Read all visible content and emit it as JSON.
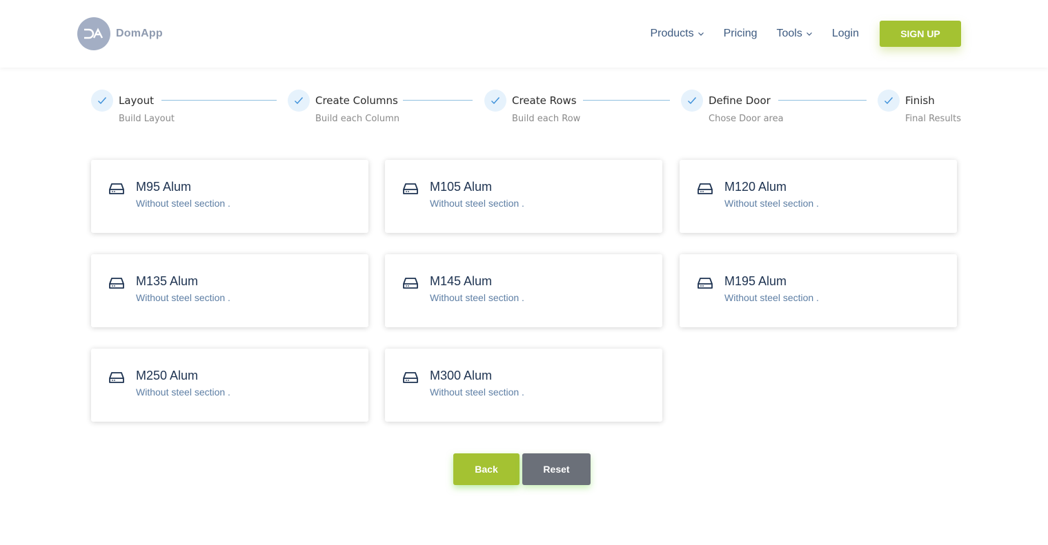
{
  "brand": {
    "initials": "DA",
    "name": "DomApp"
  },
  "nav": {
    "products": "Products",
    "pricing": "Pricing",
    "tools": "Tools",
    "login": "Login",
    "signup": "SIGN UP"
  },
  "steps": [
    {
      "title": "Layout",
      "subtitle": "Build Layout"
    },
    {
      "title": "Create Columns",
      "subtitle": "Build each Column"
    },
    {
      "title": "Create Rows",
      "subtitle": "Build each Row"
    },
    {
      "title": "Define Door",
      "subtitle": "Chose Door area"
    },
    {
      "title": "Finish",
      "subtitle": "Final Results"
    }
  ],
  "cards": [
    {
      "title": "M95 Alum",
      "subtitle": "Without steel section ."
    },
    {
      "title": "M105 Alum",
      "subtitle": "Without steel section ."
    },
    {
      "title": "M120 Alum",
      "subtitle": "Without steel section ."
    },
    {
      "title": "M135 Alum",
      "subtitle": "Without steel section ."
    },
    {
      "title": "M145 Alum",
      "subtitle": "Without steel section ."
    },
    {
      "title": "M195 Alum",
      "subtitle": "Without steel section ."
    },
    {
      "title": "M250 Alum",
      "subtitle": "Without steel section ."
    },
    {
      "title": "M300 Alum",
      "subtitle": "Without steel section ."
    }
  ],
  "buttons": {
    "back": "Back",
    "reset": "Reset"
  },
  "colors": {
    "accent": "#a4c232",
    "reset": "#6b7079",
    "nav_text": "#3d5a80",
    "step_line": "#8fbfe0"
  },
  "icons": {
    "step": "check-icon",
    "card": "hard-drive-icon",
    "dropdown": "chevron-down-icon"
  }
}
